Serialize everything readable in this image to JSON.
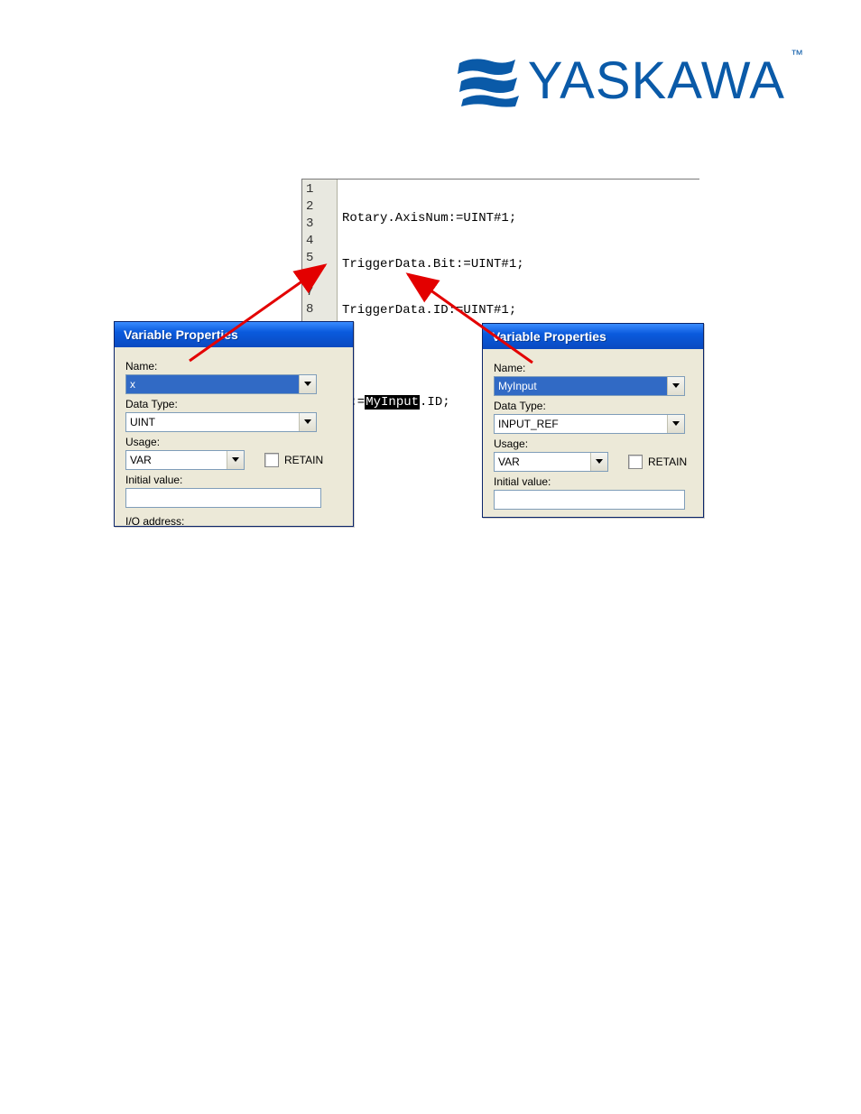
{
  "brand": {
    "name": "YASKAWA",
    "tm": "™",
    "color": "#0a5aa8"
  },
  "code": {
    "line1": "Rotary.AxisNum:=UINT#1;",
    "line2": "TriggerData.Bit:=UINT#1;",
    "line3": "TriggerData.ID:=UINT#1;",
    "line5_pre": "x:=",
    "line5_hl": "MyInput",
    "line5_post": ".ID;"
  },
  "gutter": [
    "1",
    "2",
    "3",
    "4",
    "5",
    "6",
    "7",
    "8"
  ],
  "left": {
    "title": "Variable Properties",
    "name_label": "Name:",
    "name_value": "x",
    "datatype_label": "Data Type:",
    "datatype_value": "UINT",
    "usage_label": "Usage:",
    "usage_value": "VAR",
    "retain_label": "RETAIN",
    "initial_label": "Initial value:",
    "initial_value": "",
    "io_label": "I/O address:"
  },
  "right": {
    "title": "Variable Properties",
    "name_label": "Name:",
    "name_value": "MyInput",
    "datatype_label": "Data Type:",
    "datatype_value": "INPUT_REF",
    "usage_label": "Usage:",
    "usage_value": "VAR",
    "retain_label": "RETAIN",
    "initial_label": "Initial value:",
    "initial_value": ""
  }
}
